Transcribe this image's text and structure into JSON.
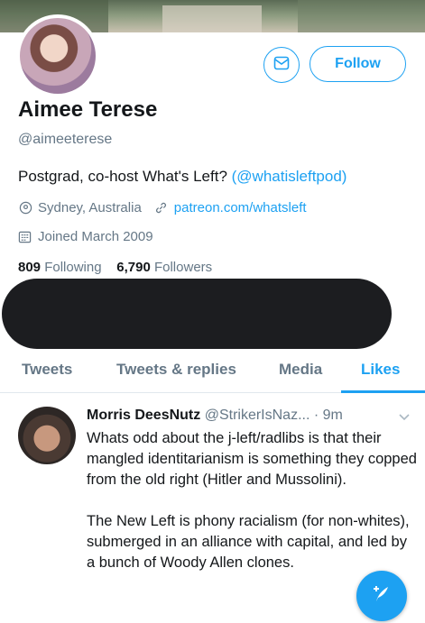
{
  "profile": {
    "follow_label": "Follow",
    "name": "Aimee Terese",
    "handle": "@aimeeterese",
    "bio_text": "Postgrad, co-host What's Left? ",
    "bio_link": "(@whatisleftpod)",
    "location": "Sydney, Australia",
    "website": "patreon.com/whatsleft",
    "joined": "Joined March 2009",
    "following_count": "809",
    "following_label": "Following",
    "followers_count": "6,790",
    "followers_label": "Followers"
  },
  "tabs": [
    {
      "label": "Tweets"
    },
    {
      "label": "Tweets & replies"
    },
    {
      "label": "Media"
    },
    {
      "label": "Likes"
    }
  ],
  "tweet": {
    "author_name": "Morris DeesNutz",
    "author_handle": "@StrikerIsNaz...",
    "time": "· 9m",
    "paragraph1": "Whats odd about the j-left/radlibs is that their mangled identitarianism is something they copped from the old right (Hitler and Mussolini).",
    "paragraph2": "The New Left is phony racialism (for non-whites), submerged in an alliance with capital, and led by a bunch of Woody Allen clones."
  },
  "colors": {
    "accent": "#1da1f2",
    "secondary_text": "#657786",
    "primary_text": "#14171a"
  },
  "icons": [
    "envelope-icon",
    "location-pin-icon",
    "link-icon",
    "calendar-icon",
    "chevron-down-icon",
    "compose-icon"
  ]
}
